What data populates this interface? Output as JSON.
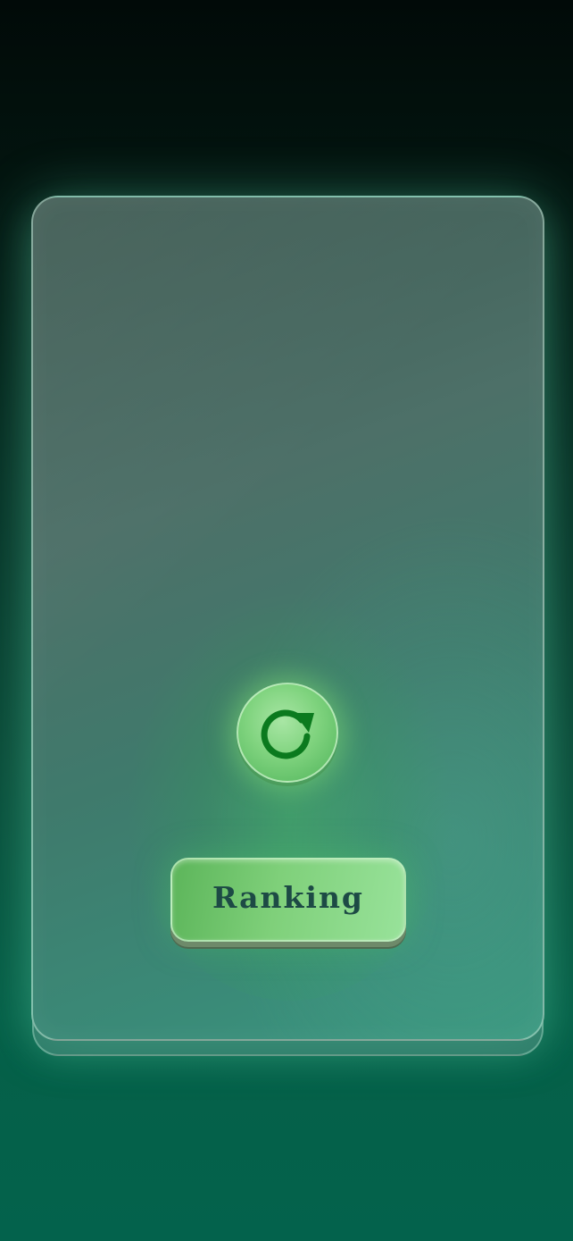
{
  "screen": {
    "refresh_button": {
      "icon": "refresh-icon",
      "icon_color": "#0b7a1e",
      "fill_color": "#7fd37e"
    },
    "ranking_button": {
      "label": "Ranking",
      "text_color": "#1d4a45",
      "fill_color": "#7fd07a"
    }
  },
  "colors": {
    "background_top": "#010a08",
    "background_bottom": "#03624c",
    "panel": "#4d7068"
  }
}
